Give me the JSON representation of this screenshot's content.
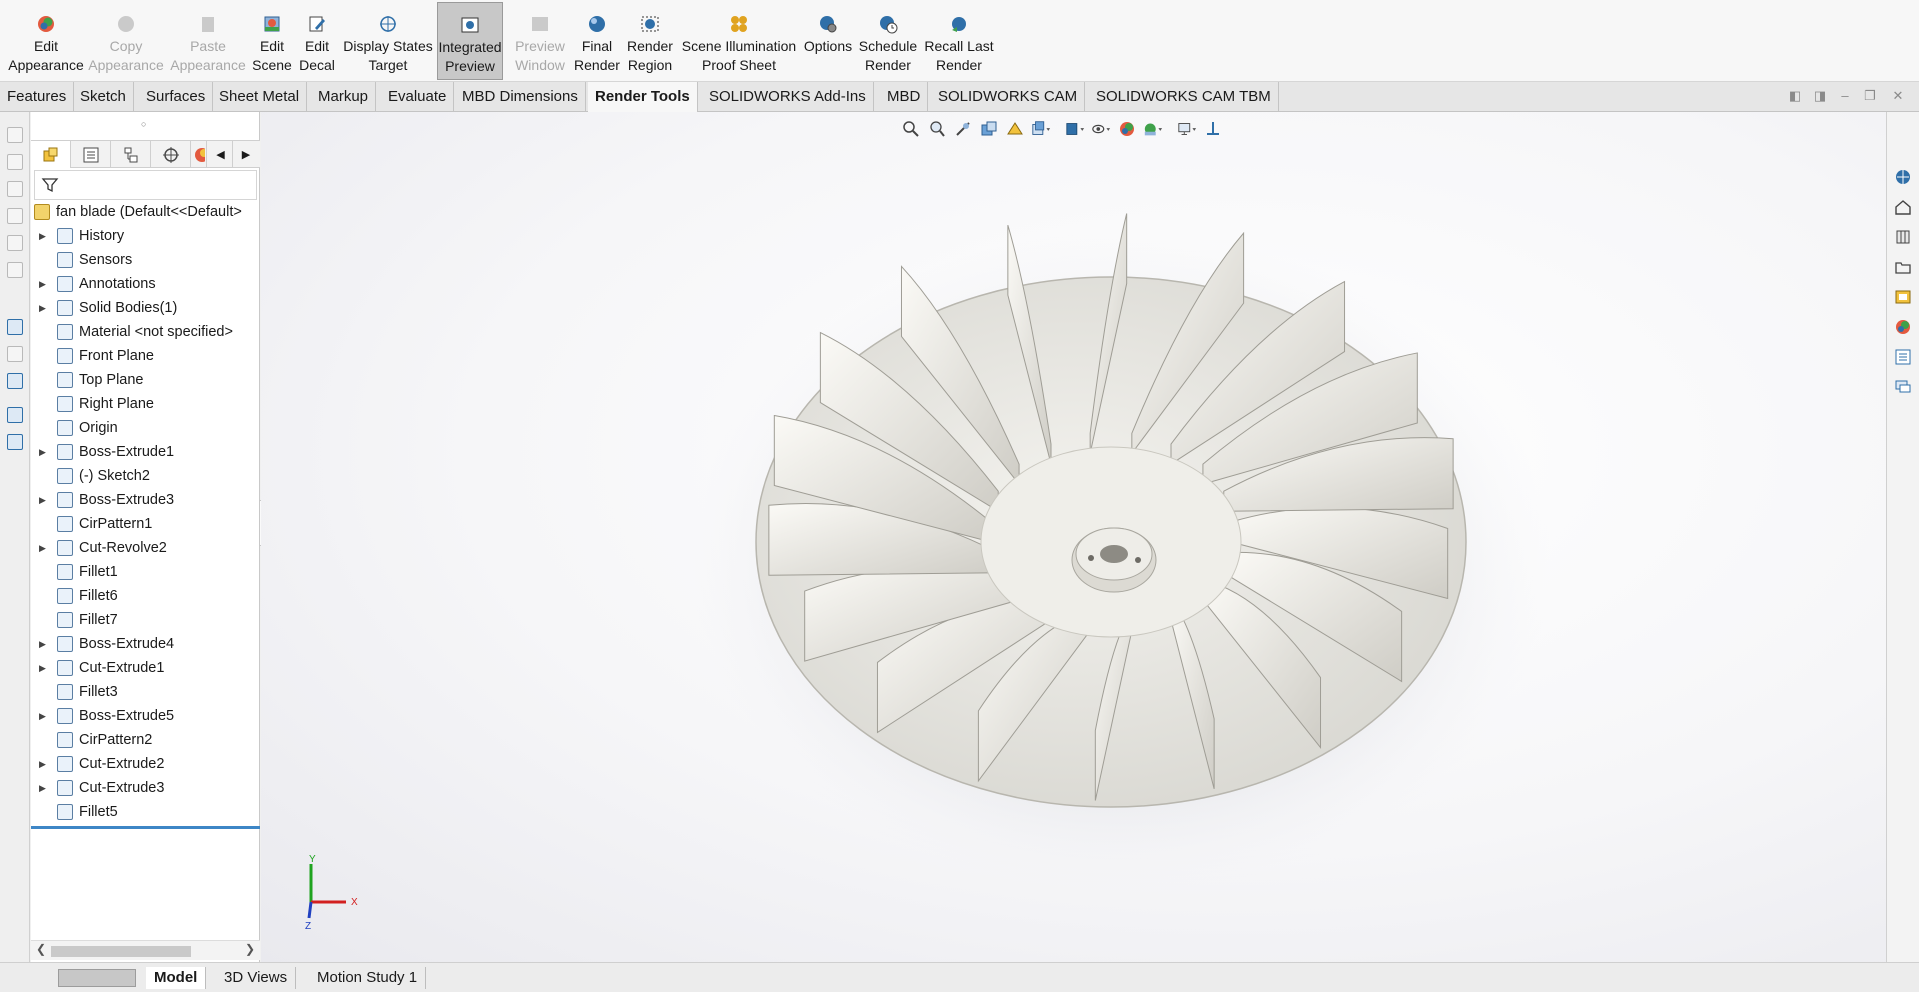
{
  "ribbon": {
    "buttons": [
      {
        "line1": "Edit",
        "line2": "Appearance",
        "icon": "edit-appearance-icon",
        "state": "enabled"
      },
      {
        "line1": "Copy",
        "line2": "Appearance",
        "icon": "copy-appearance-icon",
        "state": "disabled"
      },
      {
        "line1": "Paste",
        "line2": "Appearance",
        "icon": "paste-appearance-icon",
        "state": "disabled"
      },
      {
        "line1": "Edit",
        "line2": "Scene",
        "icon": "edit-scene-icon",
        "state": "enabled"
      },
      {
        "line1": "Edit",
        "line2": "Decal",
        "icon": "edit-decal-icon",
        "state": "enabled"
      },
      {
        "line1": "Display States",
        "line2": "Target",
        "icon": "target-icon",
        "state": "enabled"
      },
      {
        "line1": "Integrated",
        "line2": "Preview",
        "icon": "integrated-preview-icon",
        "state": "active"
      },
      {
        "line1": "Preview",
        "line2": "Window",
        "icon": "preview-window-icon",
        "state": "disabled"
      },
      {
        "line1": "Final",
        "line2": "Render",
        "icon": "final-render-icon",
        "state": "enabled"
      },
      {
        "line1": "Render",
        "line2": "Region",
        "icon": "render-region-icon",
        "state": "enabled"
      },
      {
        "line1": "Scene Illumination",
        "line2": "Proof Sheet",
        "icon": "proof-sheet-icon",
        "state": "enabled"
      },
      {
        "line1": "Options",
        "line2": "",
        "icon": "options-icon",
        "state": "enabled"
      },
      {
        "line1": "Schedule",
        "line2": "Render",
        "icon": "schedule-render-icon",
        "state": "enabled"
      },
      {
        "line1": "Recall Last",
        "line2": "Render",
        "icon": "recall-render-icon",
        "state": "enabled"
      }
    ]
  },
  "tabs": [
    "Features",
    "Sketch",
    "Surfaces",
    "Sheet Metal",
    "Markup",
    "Evaluate",
    "MBD Dimensions",
    "Render Tools",
    "SOLIDWORKS Add-Ins",
    "MBD",
    "SOLIDWORKS CAM",
    "SOLIDWORKS CAM TBM"
  ],
  "active_tab": "Render Tools",
  "tree": {
    "root": "fan blade  (Default<<Default>",
    "items": [
      {
        "label": "History",
        "expandable": true
      },
      {
        "label": "Sensors",
        "expandable": false
      },
      {
        "label": "Annotations",
        "expandable": true
      },
      {
        "label": "Solid Bodies(1)",
        "expandable": true
      },
      {
        "label": "Material <not specified>",
        "expandable": false
      },
      {
        "label": "Front Plane",
        "expandable": false
      },
      {
        "label": "Top Plane",
        "expandable": false
      },
      {
        "label": "Right Plane",
        "expandable": false
      },
      {
        "label": "Origin",
        "expandable": false
      },
      {
        "label": "Boss-Extrude1",
        "expandable": true
      },
      {
        "label": "(-) Sketch2",
        "expandable": false
      },
      {
        "label": "Boss-Extrude3",
        "expandable": true
      },
      {
        "label": "CirPattern1",
        "expandable": false
      },
      {
        "label": "Cut-Revolve2",
        "expandable": true
      },
      {
        "label": "Fillet1",
        "expandable": false
      },
      {
        "label": "Fillet6",
        "expandable": false
      },
      {
        "label": "Fillet7",
        "expandable": false
      },
      {
        "label": "Boss-Extrude4",
        "expandable": true
      },
      {
        "label": "Cut-Extrude1",
        "expandable": true
      },
      {
        "label": "Fillet3",
        "expandable": false
      },
      {
        "label": "Boss-Extrude5",
        "expandable": true
      },
      {
        "label": "CirPattern2",
        "expandable": false
      },
      {
        "label": "Cut-Extrude2",
        "expandable": true
      },
      {
        "label": "Cut-Extrude3",
        "expandable": true
      },
      {
        "label": "Fillet5",
        "expandable": false
      }
    ]
  },
  "triad": {
    "x": "X",
    "y": "Y",
    "z": "Z"
  },
  "bottom_tabs": [
    "Model",
    "3D Views",
    "Motion Study 1"
  ],
  "active_bottom_tab": "Model",
  "colors": {
    "accent": "#3d86c6",
    "active_bg": "#c8c8c8",
    "triad_x": "#d22020",
    "triad_y": "#1fa31f",
    "triad_z": "#2040c0"
  }
}
